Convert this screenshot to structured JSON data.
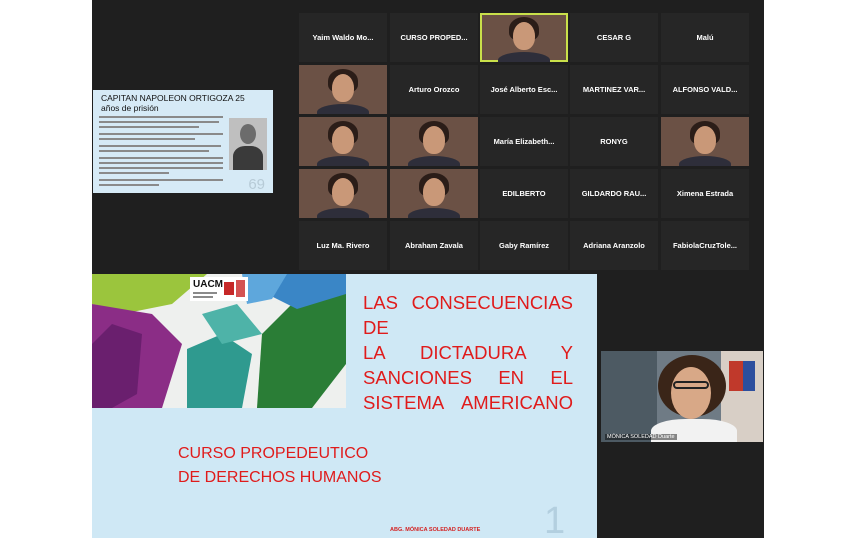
{
  "mini_slide": {
    "title": "CAPITAN NAPOLEON ORTIGOZA    25 años de prisión",
    "page_number": "69"
  },
  "gallery": {
    "tiles": [
      {
        "name": "Yaim Waldo Mo...",
        "video": false
      },
      {
        "name": "CURSO PROPED...",
        "video": false
      },
      {
        "name": "",
        "video": true,
        "active": true
      },
      {
        "name": "CESAR G",
        "video": false
      },
      {
        "name": "Malú",
        "video": false
      },
      {
        "name": "",
        "video": true
      },
      {
        "name": "Arturo Orozco",
        "video": false
      },
      {
        "name": "José Alberto Esc...",
        "video": false
      },
      {
        "name": "MARTINEZ VAR...",
        "video": false
      },
      {
        "name": "ALFONSO VALD...",
        "video": false
      },
      {
        "name": "",
        "video": true
      },
      {
        "name": "",
        "video": true
      },
      {
        "name": "María Elizabeth...",
        "video": false
      },
      {
        "name": "RONYG",
        "video": false
      },
      {
        "name": "",
        "video": true
      },
      {
        "name": "",
        "video": true
      },
      {
        "name": "",
        "video": true
      },
      {
        "name": "EDILBERTO",
        "video": false
      },
      {
        "name": "GILDARDO RAU...",
        "video": false
      },
      {
        "name": "Ximena Estrada",
        "video": false
      },
      {
        "name": "Luz Ma. Rivero",
        "video": false
      },
      {
        "name": "Abraham Zavala",
        "video": false
      },
      {
        "name": "Gaby Ramírez",
        "video": false
      },
      {
        "name": "Adriana Aranzolo",
        "video": false
      },
      {
        "name": "FabiolaCruzTole...",
        "video": false
      }
    ]
  },
  "slide": {
    "logo_text": "UACM",
    "title_lines": [
      "LAS CONSECUENCIAS DE",
      "LA DICTADURA Y",
      "SANCIONES EN EL",
      "SISTEMA AMERICANO"
    ],
    "subtitle_lines": [
      "CURSO PROPEDEUTICO",
      "DE DERECHOS HUMANOS"
    ],
    "author": "ABG. MÓNICA SOLEDAD DUARTE",
    "page_number": "1"
  },
  "speaker": {
    "name": "MÓNICA SOLEDAD Duarte"
  },
  "colors": {
    "stage_bg": "#1f1f1f",
    "tile_bg": "#262626",
    "active_border": "#c9e04a",
    "slide_title": "#e01b1b",
    "slide_bg": "#cfe8f5"
  }
}
